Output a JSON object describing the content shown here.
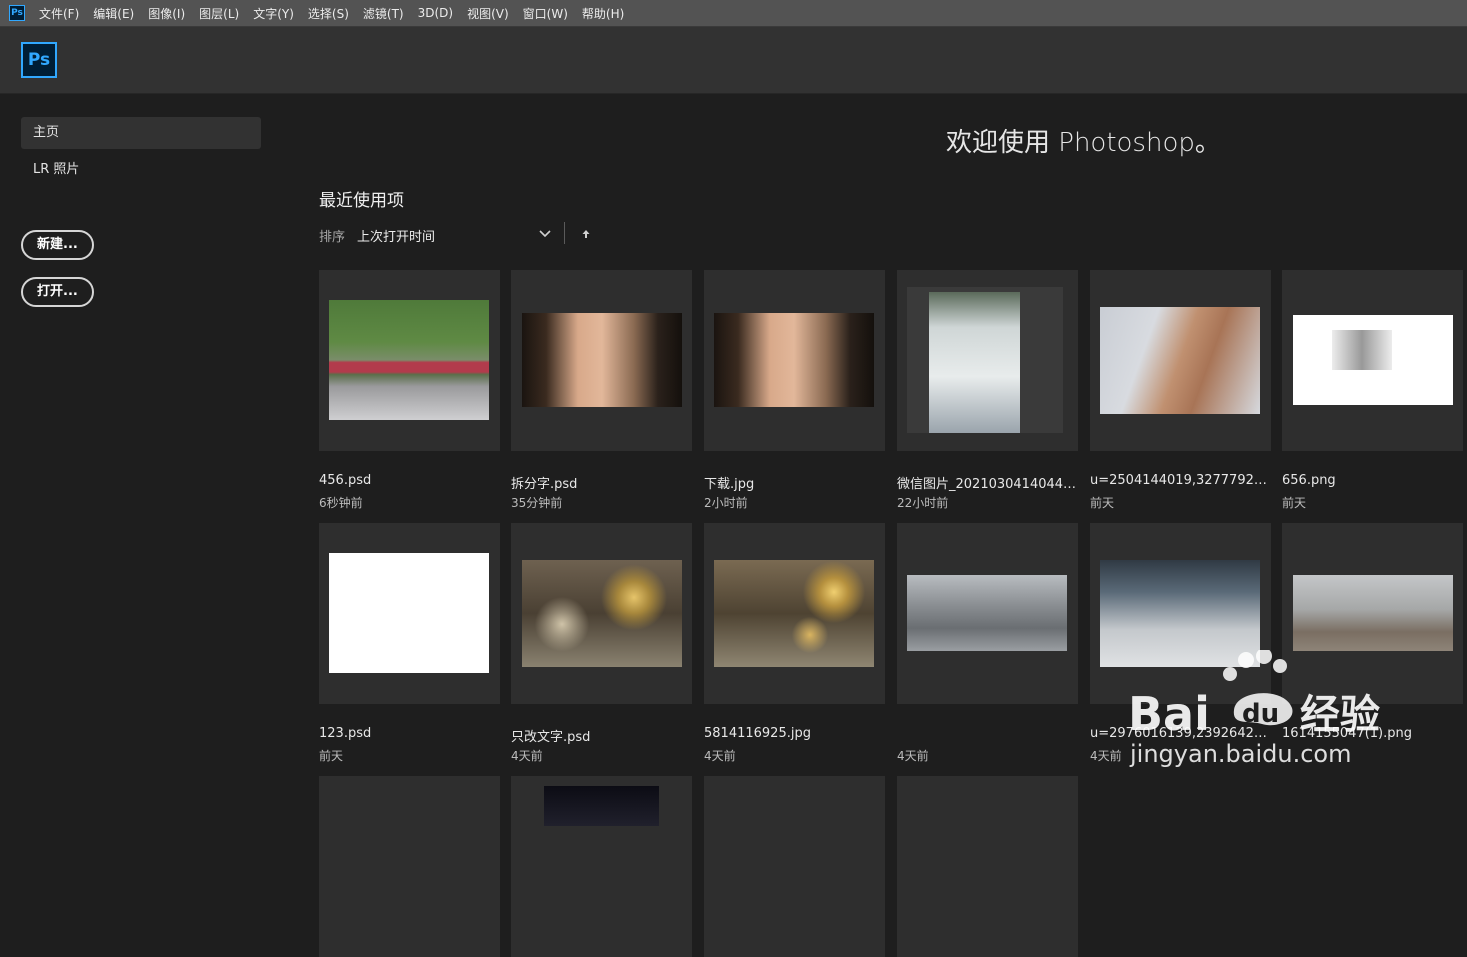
{
  "menubar": {
    "app_icon": "Ps",
    "items": [
      "文件(F)",
      "编辑(E)",
      "图像(I)",
      "图层(L)",
      "文字(Y)",
      "选择(S)",
      "滤镜(T)",
      "3D(D)",
      "视图(V)",
      "窗口(W)",
      "帮助(H)"
    ]
  },
  "topbar": {
    "logo": "Ps"
  },
  "sidebar": {
    "nav": [
      {
        "label": "主页",
        "active": true
      },
      {
        "label": "LR 照片",
        "active": false
      }
    ],
    "new_button": "新建...",
    "open_button": "打开..."
  },
  "main": {
    "welcome": "欢迎使用 Photoshop。",
    "recent_title": "最近使用项",
    "sort_label": "排序",
    "sort_value": "上次打开时间"
  },
  "recent_files": [
    {
      "name": "456.psd",
      "time": "6秒钟前"
    },
    {
      "name": "拆分字.psd",
      "time": "35分钟前"
    },
    {
      "name": "下载.jpg",
      "time": "2小时前"
    },
    {
      "name": "微信图片_20210304140440...",
      "time": "22小时前"
    },
    {
      "name": "u=2504144019,327779248...",
      "time": "前天"
    },
    {
      "name": "656.png",
      "time": "前天"
    },
    {
      "name": "123.psd",
      "time": "前天"
    },
    {
      "name": "只改文字.psd",
      "time": "4天前"
    },
    {
      "name": "5814116925.jpg",
      "time": "4天前"
    },
    {
      "name": "",
      "time": "4天前"
    },
    {
      "name": "u=2976016139,239264295...",
      "time": "4天前"
    },
    {
      "name": "1614155047(1).png",
      "time": ""
    }
  ],
  "watermark": {
    "brand": "Bai",
    "brand2": "du",
    "brand_cn": "经验",
    "url": "jingyan.baidu.com"
  },
  "colors": {
    "ps_blue": "#31a8ff",
    "ps_dark": "#001e36",
    "background": "#1e1e1e",
    "card": "#2e2e2e"
  }
}
